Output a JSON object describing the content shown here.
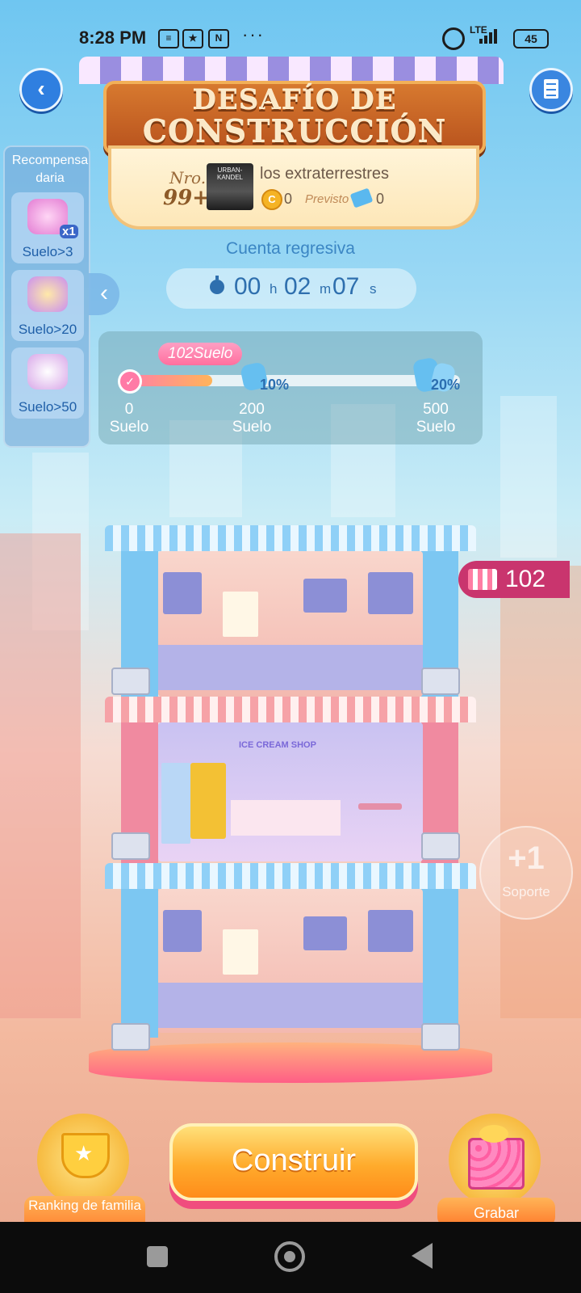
{
  "status_bar": {
    "time": "8:28 PM",
    "network": "LTE",
    "battery": "45"
  },
  "header": {
    "title_line1": "DESAFÍO DE",
    "title_line2": "CONSTRUCCIÓN"
  },
  "rank_card": {
    "nro_label": "Nro.",
    "rank": "99+",
    "family_name": "los extraterrestres",
    "coins": "0",
    "previsto_label": "Previsto",
    "tickets": "0"
  },
  "daily_reward": {
    "title": "Recompensa daria",
    "items": [
      {
        "label": "Suelo>3",
        "badge": "x1"
      },
      {
        "label": "Suelo>20"
      },
      {
        "label": "Suelo>50"
      }
    ]
  },
  "countdown": {
    "label": "Cuenta regresiva",
    "hours": "00",
    "h_unit": "h",
    "minutes": "02",
    "m_unit": "m",
    "seconds": "07",
    "s_unit": "s"
  },
  "progress": {
    "current_badge": "102Suelo",
    "current_floor": 102,
    "max_floor": 500,
    "milestones": [
      {
        "value": "0",
        "unit": "Suelo"
      },
      {
        "value": "200",
        "unit": "Suelo",
        "bonus": "10%"
      },
      {
        "value": "500",
        "unit": "Suelo",
        "bonus": "20%"
      }
    ]
  },
  "floors_count": "102",
  "support": {
    "plus": "+1",
    "label": "Soporte"
  },
  "buttons": {
    "build": "Construir",
    "ranking": "Ranking de familia",
    "record": "Grabar"
  },
  "colors": {
    "accent_pink": "#c9356e",
    "build_orange": "#ffab2c",
    "sign_brown": "#b8521d"
  }
}
